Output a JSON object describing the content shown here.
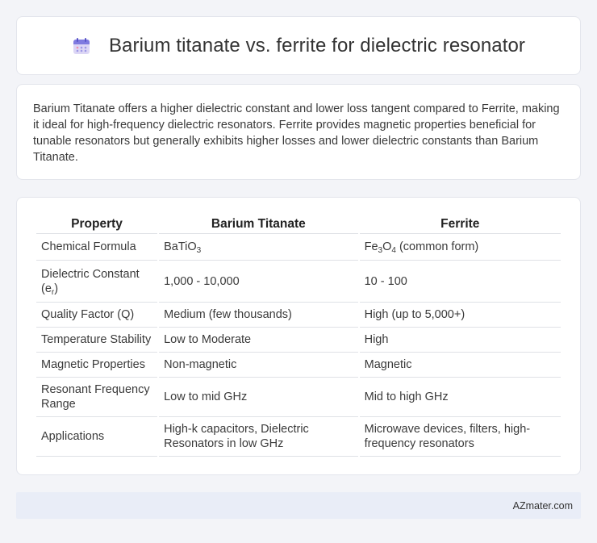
{
  "header": {
    "title": "Barium titanate vs. ferrite for dielectric resonator",
    "icon": "calendar-icon"
  },
  "summary": {
    "text": "Barium Titanate offers a higher dielectric constant and lower loss tangent compared to Ferrite, making it ideal for high-frequency dielectric resonators. Ferrite provides magnetic properties beneficial for tunable resonators but generally exhibits higher losses and lower dielectric constants than Barium Titanate."
  },
  "table": {
    "headers": [
      "Property",
      "Barium Titanate",
      "Ferrite"
    ],
    "rows": [
      {
        "property": "Chemical Formula",
        "bt_prefix": "BaTiO",
        "bt_sub": "3",
        "fe_a": "Fe",
        "fe_sub1": "3",
        "fe_b": "O",
        "fe_sub2": "4",
        "fe_c": " (common form)"
      },
      {
        "property_a": "Dielectric Constant (e",
        "property_sub": "r",
        "property_b": ")",
        "bt": "1,000 - 10,000",
        "fe": "10 - 100"
      },
      {
        "property": "Quality Factor (Q)",
        "bt": "Medium (few thousands)",
        "fe": "High (up to 5,000+)"
      },
      {
        "property": "Temperature Stability",
        "bt": "Low to Moderate",
        "fe": "High"
      },
      {
        "property": "Magnetic Properties",
        "bt": "Non-magnetic",
        "fe": "Magnetic"
      },
      {
        "property": "Resonant Frequency Range",
        "bt": "Low to mid GHz",
        "fe": "Mid to high GHz"
      },
      {
        "property": "Applications",
        "bt": "High-k capacitors, Dielectric Resonators in low GHz",
        "fe": "Microwave devices, filters, high-frequency resonators"
      }
    ]
  },
  "footer": {
    "brand": "AZmater.com"
  }
}
